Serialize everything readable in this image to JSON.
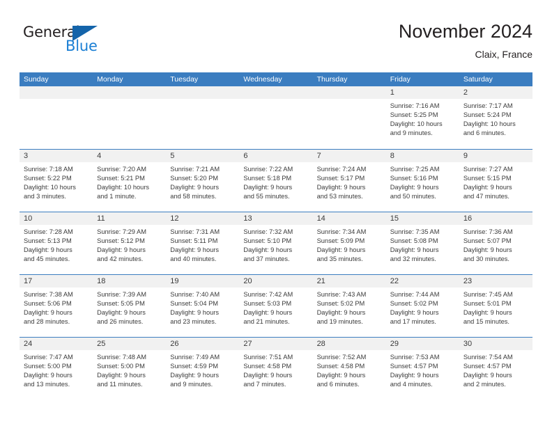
{
  "brand": {
    "name_part1": "General",
    "name_part2": "Blue",
    "triangle_color": "#1464aa",
    "blue_color": "#1b7fd4"
  },
  "header": {
    "title": "November 2024",
    "subtitle": "Claix, France"
  },
  "theme": {
    "header_bg": "#3b7dc0",
    "header_text": "#ffffff",
    "daystrip_bg": "#f1f1f1",
    "text": "#3a3a3a"
  },
  "weekdays": [
    "Sunday",
    "Monday",
    "Tuesday",
    "Wednesday",
    "Thursday",
    "Friday",
    "Saturday"
  ],
  "weeks": [
    [
      {
        "date": "",
        "lines": []
      },
      {
        "date": "",
        "lines": []
      },
      {
        "date": "",
        "lines": []
      },
      {
        "date": "",
        "lines": []
      },
      {
        "date": "",
        "lines": []
      },
      {
        "date": "1",
        "lines": [
          "Sunrise: 7:16 AM",
          "Sunset: 5:25 PM",
          "Daylight: 10 hours",
          "and 9 minutes."
        ]
      },
      {
        "date": "2",
        "lines": [
          "Sunrise: 7:17 AM",
          "Sunset: 5:24 PM",
          "Daylight: 10 hours",
          "and 6 minutes."
        ]
      }
    ],
    [
      {
        "date": "3",
        "lines": [
          "Sunrise: 7:18 AM",
          "Sunset: 5:22 PM",
          "Daylight: 10 hours",
          "and 3 minutes."
        ]
      },
      {
        "date": "4",
        "lines": [
          "Sunrise: 7:20 AM",
          "Sunset: 5:21 PM",
          "Daylight: 10 hours",
          "and 1 minute."
        ]
      },
      {
        "date": "5",
        "lines": [
          "Sunrise: 7:21 AM",
          "Sunset: 5:20 PM",
          "Daylight: 9 hours",
          "and 58 minutes."
        ]
      },
      {
        "date": "6",
        "lines": [
          "Sunrise: 7:22 AM",
          "Sunset: 5:18 PM",
          "Daylight: 9 hours",
          "and 55 minutes."
        ]
      },
      {
        "date": "7",
        "lines": [
          "Sunrise: 7:24 AM",
          "Sunset: 5:17 PM",
          "Daylight: 9 hours",
          "and 53 minutes."
        ]
      },
      {
        "date": "8",
        "lines": [
          "Sunrise: 7:25 AM",
          "Sunset: 5:16 PM",
          "Daylight: 9 hours",
          "and 50 minutes."
        ]
      },
      {
        "date": "9",
        "lines": [
          "Sunrise: 7:27 AM",
          "Sunset: 5:15 PM",
          "Daylight: 9 hours",
          "and 47 minutes."
        ]
      }
    ],
    [
      {
        "date": "10",
        "lines": [
          "Sunrise: 7:28 AM",
          "Sunset: 5:13 PM",
          "Daylight: 9 hours",
          "and 45 minutes."
        ]
      },
      {
        "date": "11",
        "lines": [
          "Sunrise: 7:29 AM",
          "Sunset: 5:12 PM",
          "Daylight: 9 hours",
          "and 42 minutes."
        ]
      },
      {
        "date": "12",
        "lines": [
          "Sunrise: 7:31 AM",
          "Sunset: 5:11 PM",
          "Daylight: 9 hours",
          "and 40 minutes."
        ]
      },
      {
        "date": "13",
        "lines": [
          "Sunrise: 7:32 AM",
          "Sunset: 5:10 PM",
          "Daylight: 9 hours",
          "and 37 minutes."
        ]
      },
      {
        "date": "14",
        "lines": [
          "Sunrise: 7:34 AM",
          "Sunset: 5:09 PM",
          "Daylight: 9 hours",
          "and 35 minutes."
        ]
      },
      {
        "date": "15",
        "lines": [
          "Sunrise: 7:35 AM",
          "Sunset: 5:08 PM",
          "Daylight: 9 hours",
          "and 32 minutes."
        ]
      },
      {
        "date": "16",
        "lines": [
          "Sunrise: 7:36 AM",
          "Sunset: 5:07 PM",
          "Daylight: 9 hours",
          "and 30 minutes."
        ]
      }
    ],
    [
      {
        "date": "17",
        "lines": [
          "Sunrise: 7:38 AM",
          "Sunset: 5:06 PM",
          "Daylight: 9 hours",
          "and 28 minutes."
        ]
      },
      {
        "date": "18",
        "lines": [
          "Sunrise: 7:39 AM",
          "Sunset: 5:05 PM",
          "Daylight: 9 hours",
          "and 26 minutes."
        ]
      },
      {
        "date": "19",
        "lines": [
          "Sunrise: 7:40 AM",
          "Sunset: 5:04 PM",
          "Daylight: 9 hours",
          "and 23 minutes."
        ]
      },
      {
        "date": "20",
        "lines": [
          "Sunrise: 7:42 AM",
          "Sunset: 5:03 PM",
          "Daylight: 9 hours",
          "and 21 minutes."
        ]
      },
      {
        "date": "21",
        "lines": [
          "Sunrise: 7:43 AM",
          "Sunset: 5:02 PM",
          "Daylight: 9 hours",
          "and 19 minutes."
        ]
      },
      {
        "date": "22",
        "lines": [
          "Sunrise: 7:44 AM",
          "Sunset: 5:02 PM",
          "Daylight: 9 hours",
          "and 17 minutes."
        ]
      },
      {
        "date": "23",
        "lines": [
          "Sunrise: 7:45 AM",
          "Sunset: 5:01 PM",
          "Daylight: 9 hours",
          "and 15 minutes."
        ]
      }
    ],
    [
      {
        "date": "24",
        "lines": [
          "Sunrise: 7:47 AM",
          "Sunset: 5:00 PM",
          "Daylight: 9 hours",
          "and 13 minutes."
        ]
      },
      {
        "date": "25",
        "lines": [
          "Sunrise: 7:48 AM",
          "Sunset: 5:00 PM",
          "Daylight: 9 hours",
          "and 11 minutes."
        ]
      },
      {
        "date": "26",
        "lines": [
          "Sunrise: 7:49 AM",
          "Sunset: 4:59 PM",
          "Daylight: 9 hours",
          "and 9 minutes."
        ]
      },
      {
        "date": "27",
        "lines": [
          "Sunrise: 7:51 AM",
          "Sunset: 4:58 PM",
          "Daylight: 9 hours",
          "and 7 minutes."
        ]
      },
      {
        "date": "28",
        "lines": [
          "Sunrise: 7:52 AM",
          "Sunset: 4:58 PM",
          "Daylight: 9 hours",
          "and 6 minutes."
        ]
      },
      {
        "date": "29",
        "lines": [
          "Sunrise: 7:53 AM",
          "Sunset: 4:57 PM",
          "Daylight: 9 hours",
          "and 4 minutes."
        ]
      },
      {
        "date": "30",
        "lines": [
          "Sunrise: 7:54 AM",
          "Sunset: 4:57 PM",
          "Daylight: 9 hours",
          "and 2 minutes."
        ]
      }
    ]
  ]
}
